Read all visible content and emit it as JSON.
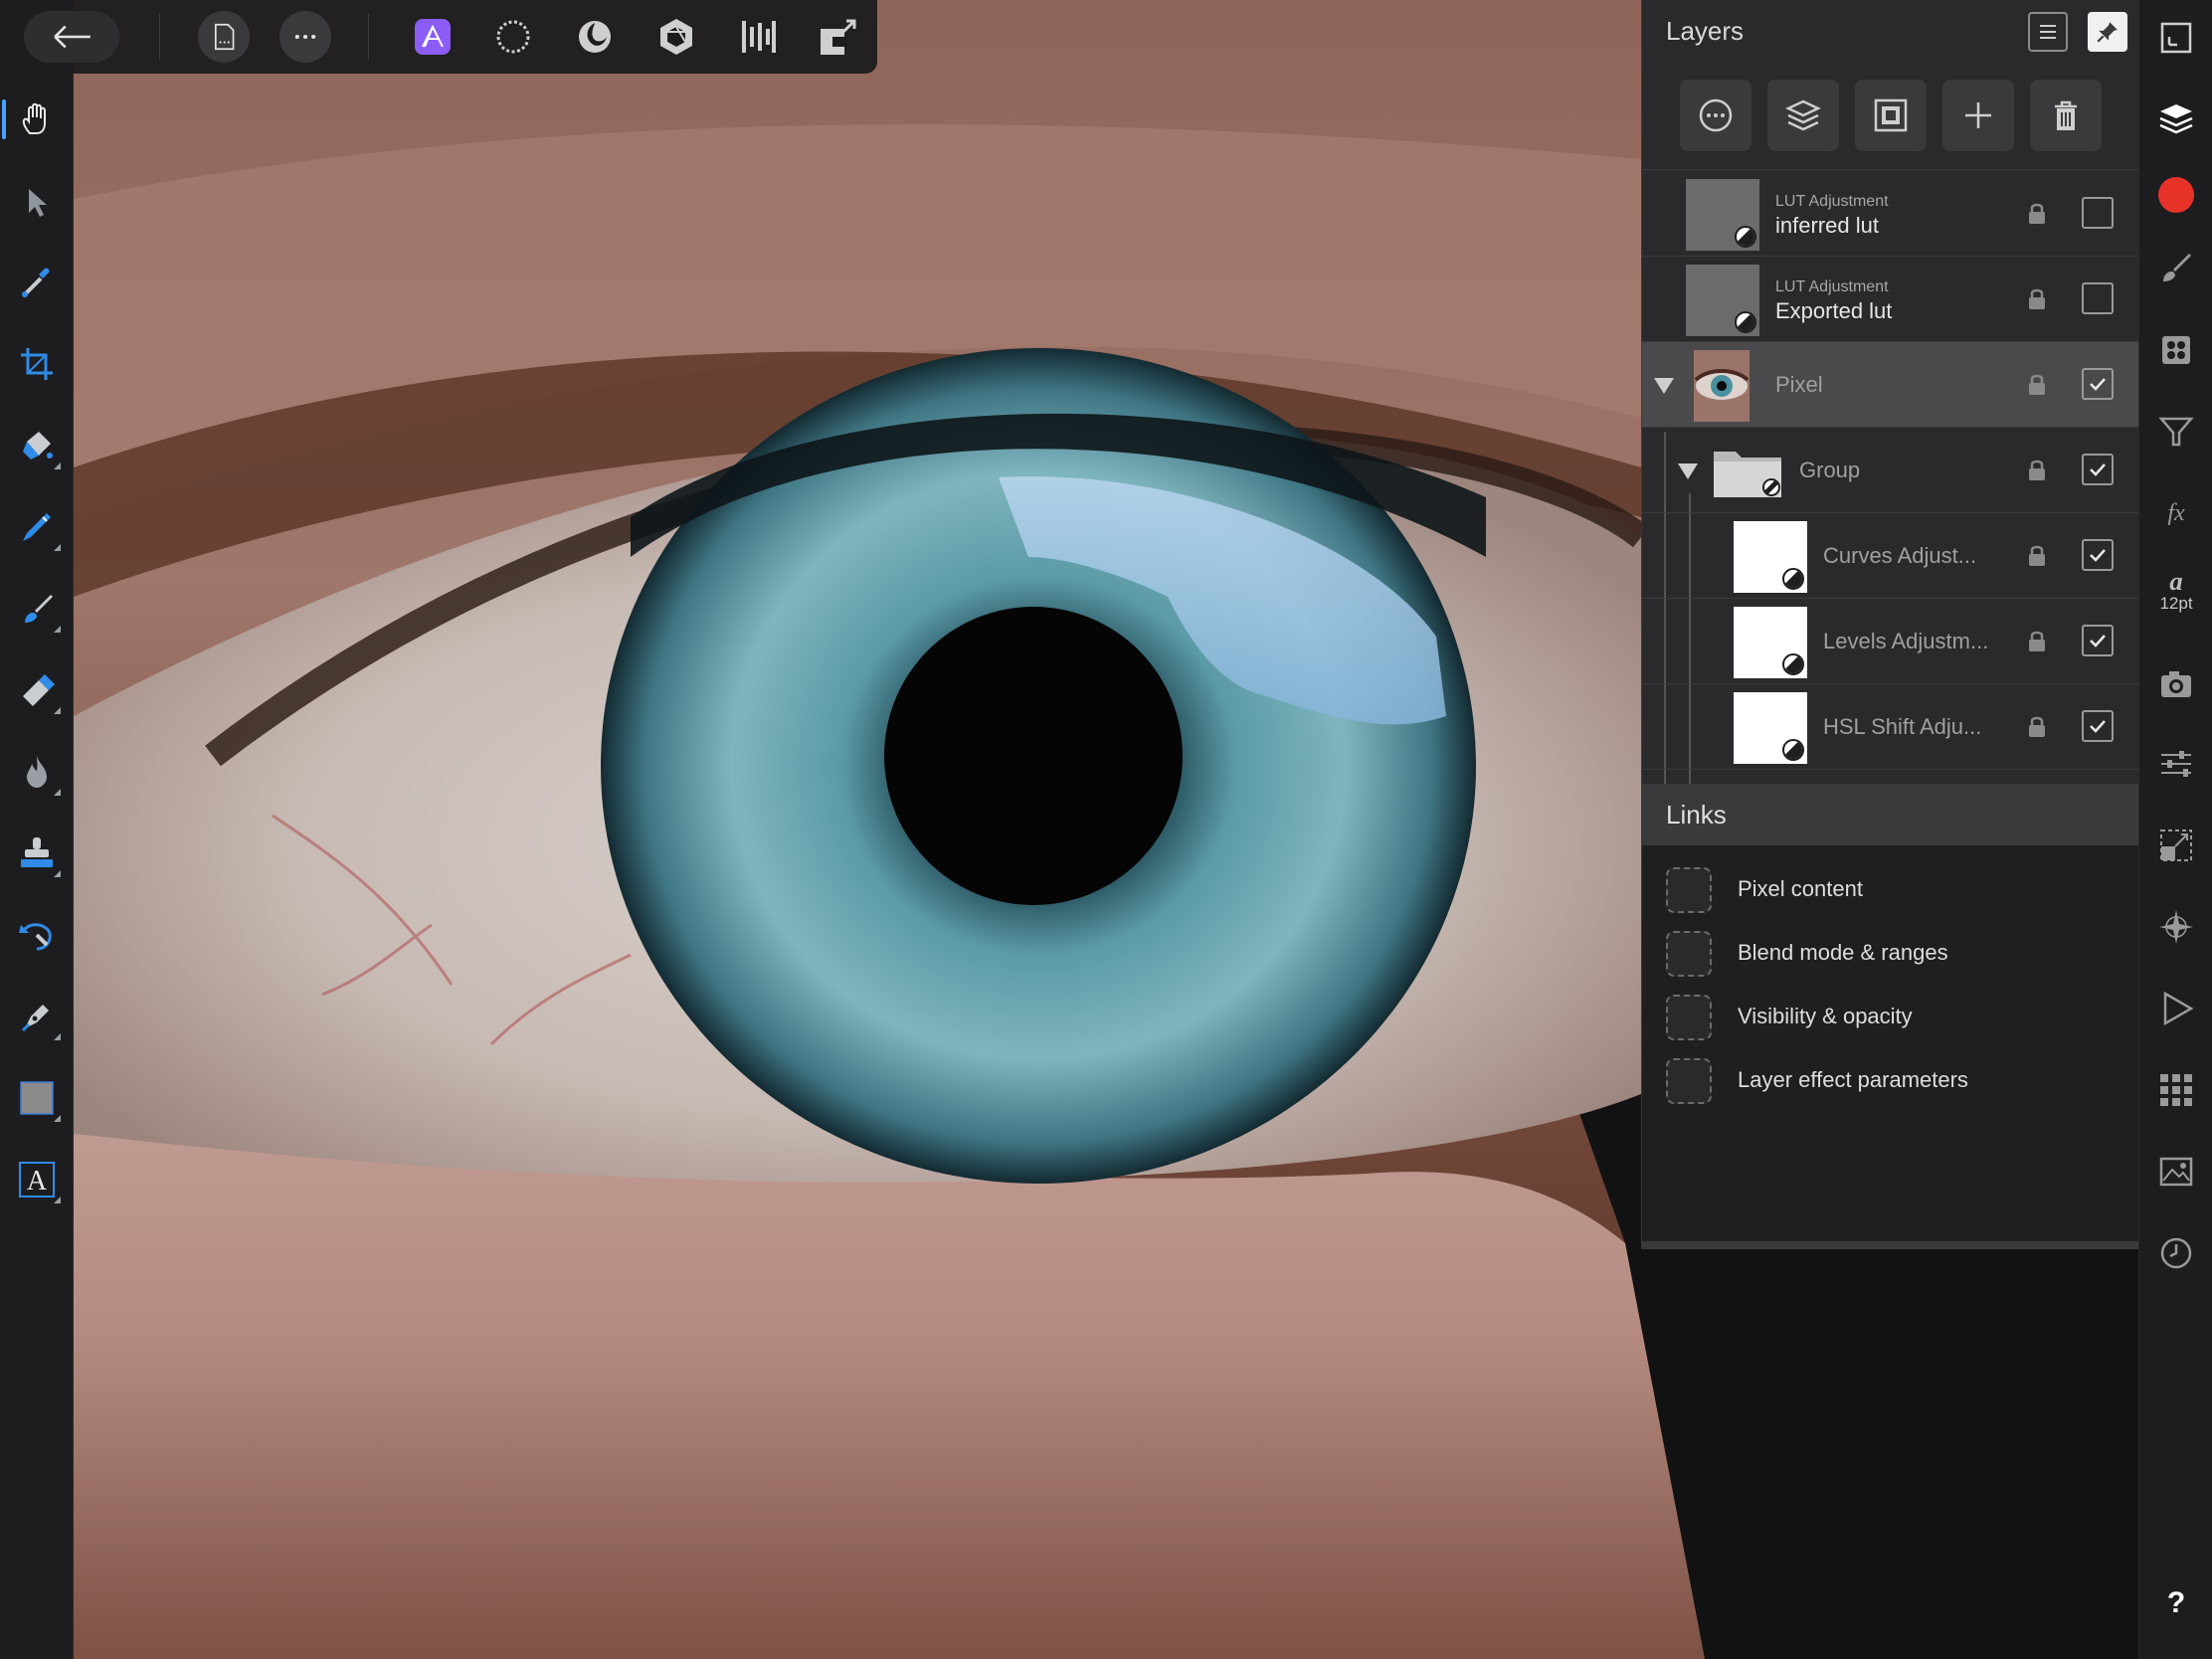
{
  "top_toolbar": {
    "items": [
      "back",
      "document",
      "more",
      "photo-persona",
      "selection-persona",
      "liquify-persona",
      "develop-persona",
      "tone-mapping-persona",
      "export-persona"
    ],
    "active_item": "photo-persona",
    "accent_color": "#8b5cf6"
  },
  "left_toolbar": {
    "tools": [
      "view-tool",
      "move-tool",
      "color-picker-tool",
      "crop-tool",
      "flood-fill-tool",
      "selection-brush-tool",
      "paint-brush-tool",
      "erase-brush-tool",
      "burn-brush-tool",
      "clone-brush-tool",
      "undo-brush-tool",
      "pen-tool",
      "rectangle-tool",
      "artistic-text-tool"
    ],
    "active_tool": "view-tool"
  },
  "layers_panel": {
    "title": "Layers",
    "layers": [
      {
        "sub": "LUT Adjustment",
        "name": "inferred lut",
        "checked": false
      },
      {
        "sub": "LUT Adjustment",
        "name": "Exported lut",
        "checked": false
      },
      {
        "sub": "",
        "name": "Pixel",
        "checked": true
      },
      {
        "sub": "",
        "name": "Group",
        "checked": true
      },
      {
        "sub": "",
        "name": "Curves Adjust...",
        "checked": true
      },
      {
        "sub": "",
        "name": "Levels Adjustm...",
        "checked": true
      },
      {
        "sub": "",
        "name": "HSL Shift Adju...",
        "checked": true
      }
    ]
  },
  "links_panel": {
    "title": "Links",
    "items": [
      {
        "label": "Pixel content",
        "checked": false
      },
      {
        "label": "Blend mode & ranges",
        "checked": false
      },
      {
        "label": "Visibility & opacity",
        "checked": false
      },
      {
        "label": "Layer effect parameters",
        "checked": false
      }
    ]
  },
  "studio_bar": {
    "items": [
      "navigator-icon",
      "layers-icon",
      "color-icon",
      "brushes-icon",
      "channels-icon",
      "histogram-icon",
      "fx-icon",
      "text-style-icon",
      "snapshots-icon",
      "adjustments-icon",
      "transform-icon",
      "stock-icon",
      "macros-icon",
      "library-icon",
      "stock-images-icon",
      "history-icon",
      "help-icon"
    ],
    "font_size": "12pt",
    "current_color": "#e8332a",
    "help_label": "?"
  }
}
